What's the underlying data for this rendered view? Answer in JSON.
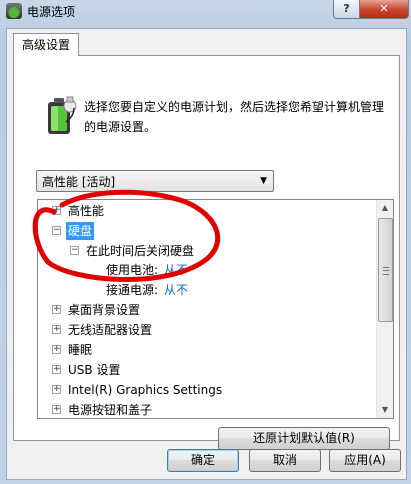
{
  "window": {
    "title": "电源选项",
    "help_label": "?",
    "close_label": "✕"
  },
  "tab": {
    "label": "高级设置"
  },
  "description": "选择您要自定义的电源计划，然后选择您希望计算机管理的电源设置。",
  "plan_select": {
    "value": "高性能 [活动]"
  },
  "tree": {
    "items": [
      {
        "label": "高性能",
        "expander": "+"
      },
      {
        "label": "硬盘",
        "expander": "−"
      },
      {
        "label": "在此时间后关闭硬盘",
        "expander": "−"
      },
      {
        "label": "使用电池:",
        "value": "从不"
      },
      {
        "label": "接通电源:",
        "value": "从不"
      },
      {
        "label": "桌面背景设置",
        "expander": "+"
      },
      {
        "label": "无线适配器设置",
        "expander": "+"
      },
      {
        "label": "睡眠",
        "expander": "+"
      },
      {
        "label": "USB 设置",
        "expander": "+"
      },
      {
        "label": "Intel(R) Graphics Settings",
        "expander": "+"
      },
      {
        "label": "电源按钮和盖子",
        "expander": "+"
      }
    ]
  },
  "buttons": {
    "restore": "还原计划默认值(R)",
    "ok": "确定",
    "cancel": "取消",
    "apply": "应用(A)"
  },
  "colors": {
    "selection": "#3399ff",
    "link": "#0a67cc",
    "annotation": "#e00000"
  }
}
